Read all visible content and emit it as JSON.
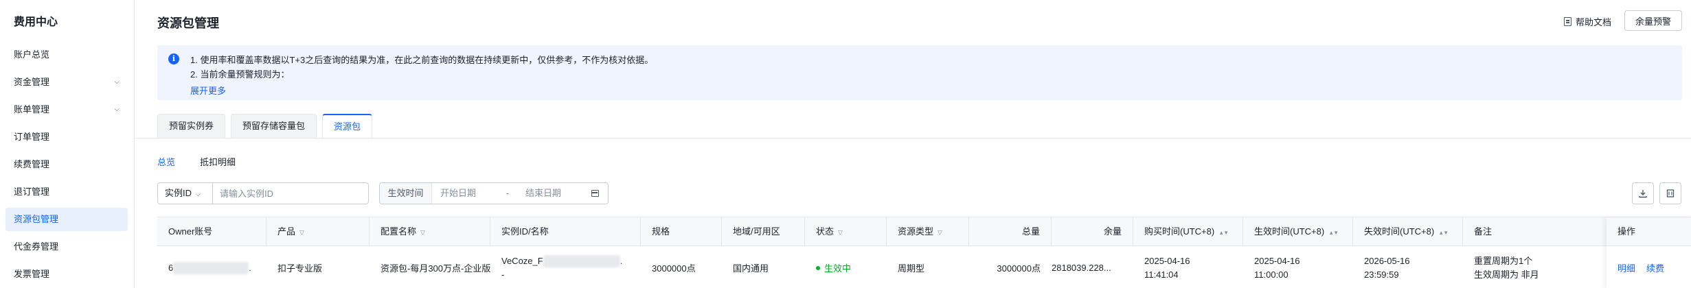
{
  "sidebar": {
    "title": "费用中心",
    "items": [
      {
        "label": "账户总览",
        "expandable": false
      },
      {
        "label": "资金管理",
        "expandable": true
      },
      {
        "label": "账单管理",
        "expandable": true
      },
      {
        "label": "订单管理",
        "expandable": false
      },
      {
        "label": "续费管理",
        "expandable": false
      },
      {
        "label": "退订管理",
        "expandable": false
      },
      {
        "label": "资源包管理",
        "expandable": false,
        "active": true
      },
      {
        "label": "代金券管理",
        "expandable": false
      },
      {
        "label": "发票管理",
        "expandable": false
      }
    ]
  },
  "header": {
    "title": "资源包管理",
    "help_label": "帮助文档",
    "alert_button": "余量预警"
  },
  "notice": {
    "line1": "1. 使用率和覆盖率数据以T+3之后查询的结果为准，在此之前查询的数据在持续更新中，仅供参考，不作为核对依据。",
    "line2": "2. 当前余量预警规则为：",
    "more": "展开更多"
  },
  "tabs": [
    {
      "label": "预留实例券"
    },
    {
      "label": "预留存储容量包"
    },
    {
      "label": "资源包",
      "active": true
    }
  ],
  "subtabs": [
    {
      "label": "总览",
      "active": true
    },
    {
      "label": "抵扣明细"
    }
  ],
  "filters": {
    "select_value": "实例ID",
    "input_placeholder": "请输入实例ID",
    "date_label": "生效时间",
    "date_start_placeholder": "开始日期",
    "date_separator": "-",
    "date_end_placeholder": "结束日期"
  },
  "table": {
    "columns": [
      "Owner账号",
      "产品",
      "配置名称",
      "实例ID/名称",
      "规格",
      "地域/可用区",
      "状态",
      "资源类型",
      "总量",
      "余量",
      "购买时间(UTC+8)",
      "生效时间(UTC+8)",
      "失效时间(UTC+8)",
      "备注",
      "操作"
    ],
    "rows": [
      {
        "owner_prefix": "6",
        "owner_suffix": ".",
        "product": "扣子专业版",
        "config": "资源包-每月300万点-企业版",
        "instance_prefix": "VeCoze_F",
        "instance_suffix": ".",
        "instance_line2": "-",
        "spec": "3000000点",
        "region": "国内通用",
        "status": "生效中",
        "resource_type": "周期型",
        "total": "3000000点",
        "remaining": "2818039.228...",
        "purchase_date": "2025-04-16",
        "purchase_time": "11:41:04",
        "effective_date": "2025-04-16",
        "effective_time": "11:00:00",
        "expire_date": "2026-05-16",
        "expire_time": "23:59:59",
        "remark_line1": "重置周期为1个",
        "remark_line2": "生效周期为 非月",
        "actions": [
          "明细",
          "续费"
        ]
      }
    ]
  },
  "colors": {
    "accent": "#1664ff",
    "status_active": "#00b42a"
  }
}
